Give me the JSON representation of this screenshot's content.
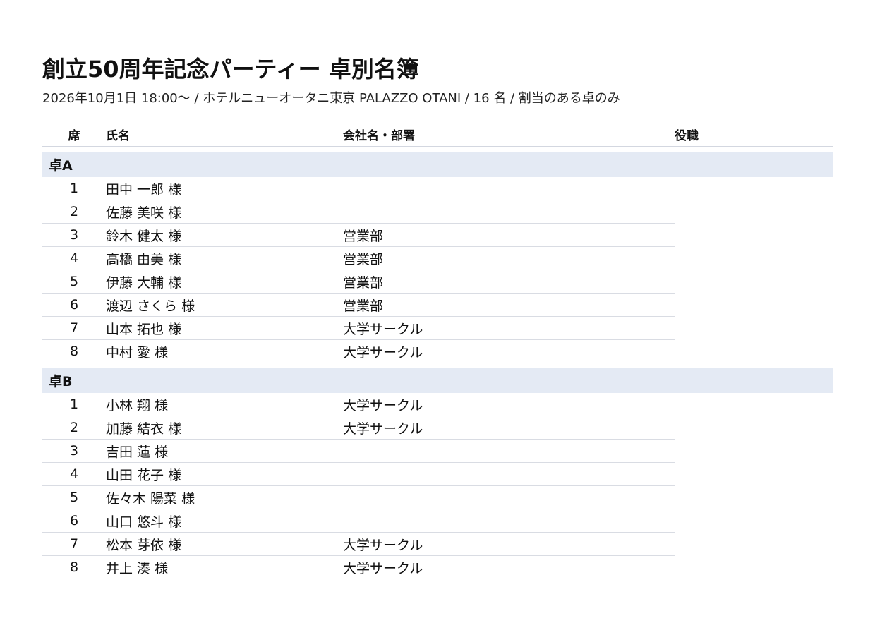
{
  "header": {
    "title": "創立50周年記念パーティー 卓別名簿",
    "subtitle": "2026年10月1日 18:00〜 / ホテルニューオータニ東京 PALAZZO OTANI / 16 名 / 割当のある卓のみ"
  },
  "columns": {
    "seat": "席",
    "name": "氏名",
    "company": "会社名・部署",
    "title": "役職"
  },
  "tables": [
    {
      "label": "卓A",
      "guests": [
        {
          "seat": "1",
          "name": "田中 一郎 様",
          "company": "",
          "title": ""
        },
        {
          "seat": "2",
          "name": "佐藤 美咲 様",
          "company": "",
          "title": ""
        },
        {
          "seat": "3",
          "name": "鈴木 健太 様",
          "company": "営業部",
          "title": ""
        },
        {
          "seat": "4",
          "name": "高橋 由美 様",
          "company": "営業部",
          "title": ""
        },
        {
          "seat": "5",
          "name": "伊藤 大輔 様",
          "company": "営業部",
          "title": ""
        },
        {
          "seat": "6",
          "name": "渡辺 さくら 様",
          "company": "営業部",
          "title": ""
        },
        {
          "seat": "7",
          "name": "山本 拓也 様",
          "company": "大学サークル",
          "title": ""
        },
        {
          "seat": "8",
          "name": "中村 愛 様",
          "company": "大学サークル",
          "title": ""
        }
      ]
    },
    {
      "label": "卓B",
      "guests": [
        {
          "seat": "1",
          "name": "小林 翔 様",
          "company": "大学サークル",
          "title": ""
        },
        {
          "seat": "2",
          "name": "加藤 結衣 様",
          "company": "大学サークル",
          "title": ""
        },
        {
          "seat": "3",
          "name": "吉田 蓮 様",
          "company": "",
          "title": ""
        },
        {
          "seat": "4",
          "name": "山田 花子 様",
          "company": "",
          "title": ""
        },
        {
          "seat": "5",
          "name": "佐々木 陽菜 様",
          "company": "",
          "title": ""
        },
        {
          "seat": "6",
          "name": "山口 悠斗 様",
          "company": "",
          "title": ""
        },
        {
          "seat": "7",
          "name": "松本 芽依 様",
          "company": "大学サークル",
          "title": ""
        },
        {
          "seat": "8",
          "name": "井上 湊 様",
          "company": "大学サークル",
          "title": ""
        }
      ]
    }
  ],
  "colors": {
    "group_band": "#e4eaf4",
    "row_divider": "#d9dce3",
    "header_divider": "#d3d7e0"
  }
}
